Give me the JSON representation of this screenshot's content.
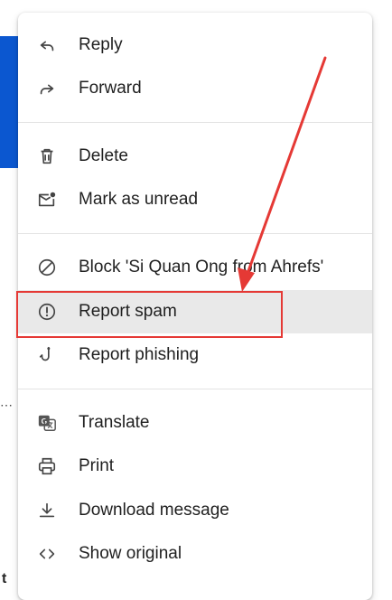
{
  "menu": {
    "items": [
      {
        "label": "Reply",
        "icon": "reply-icon"
      },
      {
        "label": "Forward",
        "icon": "forward-icon"
      },
      {
        "label": "Delete",
        "icon": "trash-icon"
      },
      {
        "label": "Mark as unread",
        "icon": "mark-unread-icon"
      },
      {
        "label": "Block 'Si Quan Ong from Ahrefs'",
        "icon": "block-icon"
      },
      {
        "label": "Report spam",
        "icon": "report-spam-icon"
      },
      {
        "label": "Report phishing",
        "icon": "phishing-hook-icon"
      },
      {
        "label": "Translate",
        "icon": "translate-icon"
      },
      {
        "label": "Print",
        "icon": "print-icon"
      },
      {
        "label": "Download message",
        "icon": "download-icon"
      },
      {
        "label": "Show original",
        "icon": "code-icon"
      }
    ]
  },
  "background": {
    "dots": "⋯",
    "partial_text": "t"
  },
  "colors": {
    "annotation": "#e53935",
    "highlight": "#e9e9e9",
    "side_blue": "#0b57d0"
  }
}
